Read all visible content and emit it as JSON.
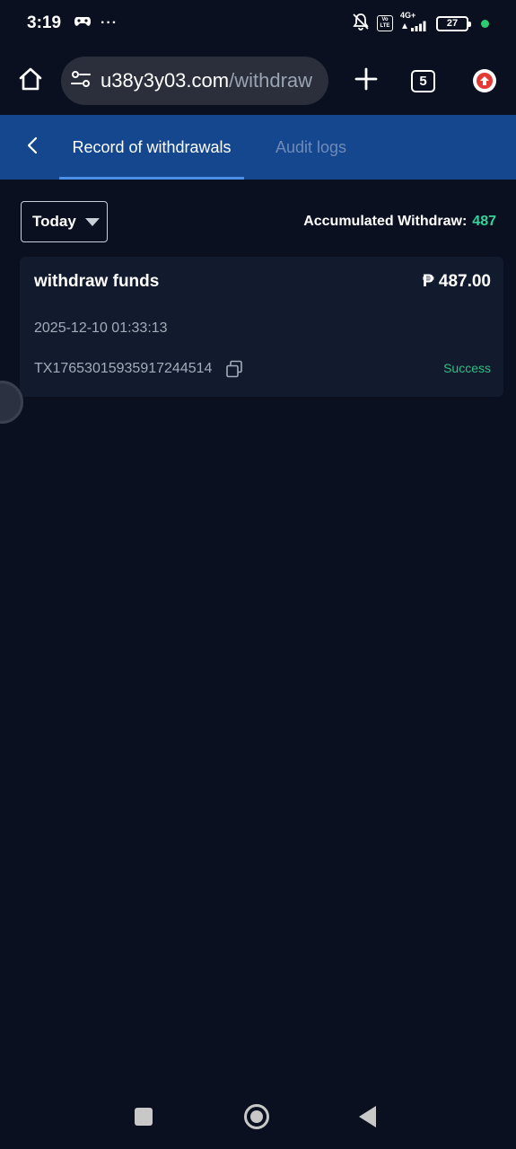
{
  "status_bar": {
    "time": "3:19",
    "more": "···",
    "network": "4G+",
    "lte_label": "Vo LTE",
    "battery": "27"
  },
  "browser": {
    "url_host": "u38y3y03.com",
    "url_path": "/withdraw",
    "tab_count": "5"
  },
  "tabs": [
    {
      "label": "Record of withdrawals",
      "active": true
    },
    {
      "label": "Audit logs",
      "active": false
    }
  ],
  "filter": {
    "period": "Today",
    "accumulated_label": "Accumulated Withdraw:",
    "accumulated_value": "487"
  },
  "records": [
    {
      "title": "withdraw funds",
      "amount": "₱ 487.00",
      "datetime": "2025-12-10 01:33:13",
      "txid": "TX17653015935917244514",
      "status": "Success"
    }
  ],
  "colors": {
    "background": "#0a1020",
    "header_blue": "#15478f",
    "accent_green": "#34d399",
    "card_bg": "#121a2d"
  },
  "icons": {
    "home": "home-icon",
    "site_settings": "site-settings-icon",
    "plus": "plus-icon",
    "update": "update-arrow-icon",
    "back": "chevron-left-icon",
    "copy": "copy-icon"
  }
}
